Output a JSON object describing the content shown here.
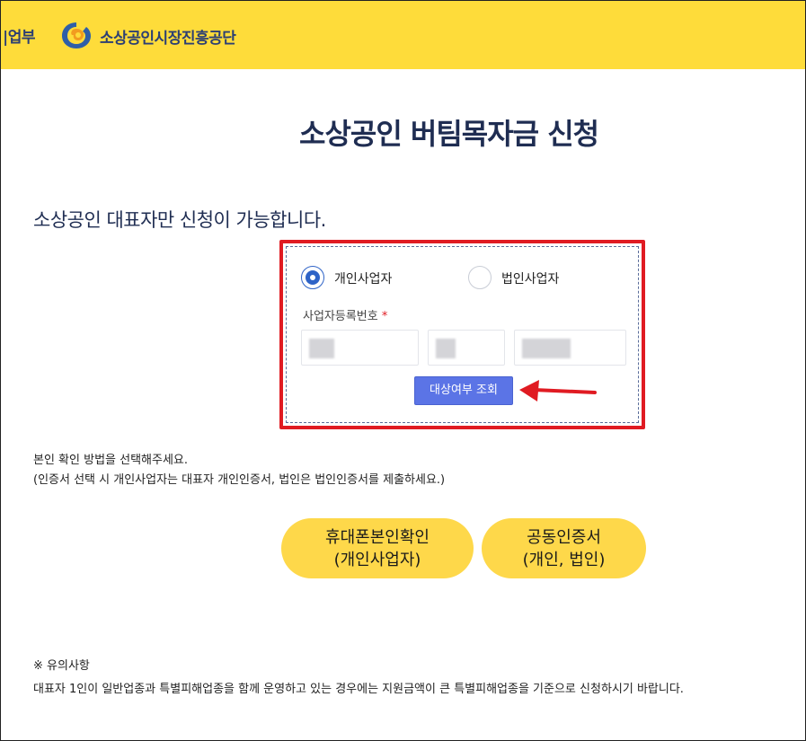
{
  "header": {
    "ministry": "|업부",
    "org_name": "소상공인시장진흥공단"
  },
  "page_title": "소상공인 버팀목자금 신청",
  "subtitle": "소상공인 대표자만 신청이 가능합니다.",
  "form": {
    "radio_individual": "개인사업자",
    "radio_corporate": "법인사업자",
    "selected": "개인사업자",
    "biz_number_label": "사업자등록번호",
    "required_mark": "*",
    "check_button": "대상여부 조회"
  },
  "auth": {
    "line1": "본인 확인 방법을 선택해주세요.",
    "line2": "(인증서 선택 시 개인사업자는 대표자 개인인증서, 법인은 법인인증서를 제출하세요.)",
    "phone_button": {
      "line1": "휴대폰본인확인",
      "line2": "(개인사업자)"
    },
    "cert_button": {
      "line1": "공동인증서",
      "line2": "(개인, 법인)"
    }
  },
  "notice": {
    "title": "※ 유의사항",
    "text": "대표자 1인이 일반업종과 특별피해업종을 함께 운영하고 있는 경우에는 지원금액이 큰 특별피해업종을 기준으로 신청하시기 바랍니다."
  },
  "colors": {
    "header_bg": "#fedc3a",
    "title": "#1f2d52",
    "highlight": "#e01b22",
    "button": "#5b74e6",
    "pill": "#fed84a"
  }
}
